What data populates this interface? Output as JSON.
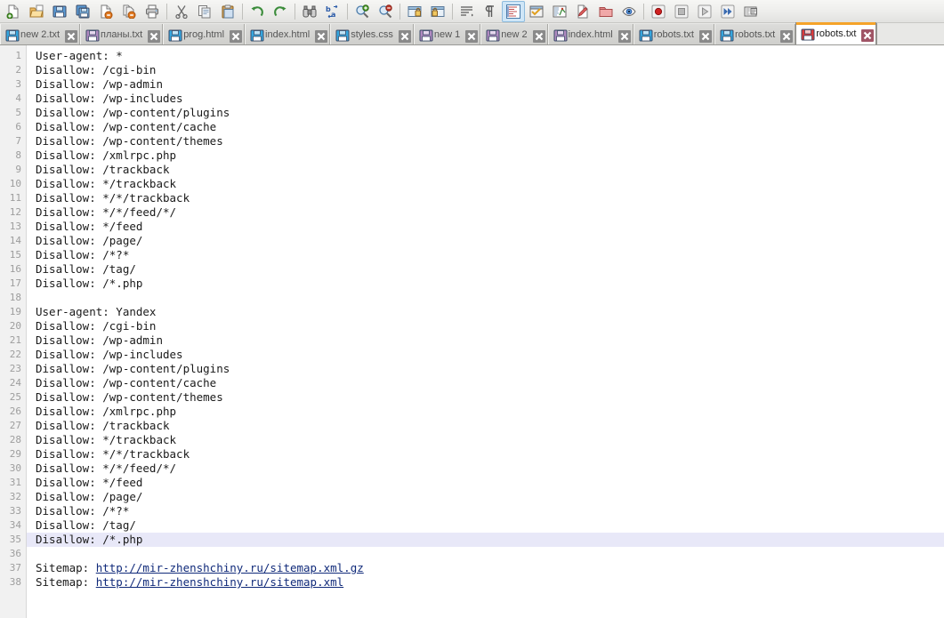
{
  "app": {
    "title": "Notepad++ editor"
  },
  "toolbar": {
    "groups": [
      {
        "name": "file",
        "buttons": [
          {
            "icon": "new-file-icon",
            "label": "New"
          },
          {
            "icon": "open-folder-icon",
            "label": "Open"
          },
          {
            "icon": "save-icon",
            "label": "Save"
          },
          {
            "icon": "save-all-icon",
            "label": "Save All"
          },
          {
            "icon": "close-file-icon",
            "label": "Close"
          },
          {
            "icon": "close-all-icon",
            "label": "Close All"
          },
          {
            "icon": "print-icon",
            "label": "Print"
          }
        ]
      },
      {
        "name": "clipboard",
        "buttons": [
          {
            "icon": "cut-scissors-icon",
            "label": "Cut"
          },
          {
            "icon": "copy-icon",
            "label": "Copy"
          },
          {
            "icon": "paste-icon",
            "label": "Paste"
          }
        ]
      },
      {
        "name": "history",
        "buttons": [
          {
            "icon": "undo-icon",
            "label": "Undo"
          },
          {
            "icon": "redo-icon",
            "label": "Redo"
          }
        ]
      },
      {
        "name": "search",
        "buttons": [
          {
            "icon": "find-binoculars-icon",
            "label": "Find"
          },
          {
            "icon": "replace-icon",
            "label": "Replace"
          }
        ]
      },
      {
        "name": "zoom",
        "buttons": [
          {
            "icon": "zoom-in-icon",
            "label": "Zoom In"
          },
          {
            "icon": "zoom-out-icon",
            "label": "Zoom Out"
          }
        ]
      },
      {
        "name": "sync",
        "buttons": [
          {
            "icon": "sync-vertical-scroll-icon",
            "label": "Synchronize Vertical Scrolling"
          },
          {
            "icon": "sync-horizontal-scroll-icon",
            "label": "Synchronize Horizontal Scrolling"
          }
        ]
      },
      {
        "name": "view",
        "buttons": [
          {
            "icon": "word-wrap-icon",
            "label": "Word Wrap"
          },
          {
            "icon": "show-all-characters-icon",
            "label": "Show All Characters"
          },
          {
            "icon": "show-indent-guide-icon",
            "label": "Show Indent Guide"
          },
          {
            "icon": "user-defined-dialog-icon",
            "label": "User Defined Dialogue"
          },
          {
            "icon": "document-map-icon",
            "label": "Document Map"
          },
          {
            "icon": "function-list-icon",
            "label": "Function List"
          },
          {
            "icon": "folder-workspace-icon",
            "label": "Folder as Workspace"
          },
          {
            "icon": "monitoring-eye-icon",
            "label": "Monitoring"
          }
        ]
      },
      {
        "name": "macro",
        "buttons": [
          {
            "icon": "record-macro-icon",
            "label": "Start Recording"
          },
          {
            "icon": "stop-recording-icon",
            "label": "Stop Recording"
          },
          {
            "icon": "play-macro-icon",
            "label": "Playback"
          },
          {
            "icon": "run-macro-multiple-icon",
            "label": "Run a Macro Multiple Times"
          },
          {
            "icon": "run-dialog-icon",
            "label": "Run"
          }
        ]
      }
    ]
  },
  "tabs": [
    {
      "label": "new 2.txt",
      "icon": "floppy-blue-icon",
      "active": false,
      "close_icon": "close-icon"
    },
    {
      "label": "планы.txt",
      "icon": "floppy-purple-icon",
      "active": false,
      "close_icon": "close-icon"
    },
    {
      "label": "prog.html",
      "icon": "floppy-blue-icon",
      "active": false,
      "close_icon": "close-icon"
    },
    {
      "label": "index.html",
      "icon": "floppy-blue-icon",
      "active": false,
      "close_icon": "close-icon"
    },
    {
      "label": "styles.css",
      "icon": "floppy-blue-icon",
      "active": false,
      "close_icon": "close-icon"
    },
    {
      "label": "new 1",
      "icon": "floppy-purple-icon",
      "active": false,
      "close_icon": "close-icon"
    },
    {
      "label": "new 2",
      "icon": "floppy-purple-icon",
      "active": false,
      "close_icon": "close-icon"
    },
    {
      "label": "index.html",
      "icon": "floppy-purple-icon",
      "active": false,
      "close_icon": "close-icon"
    },
    {
      "label": "robots.txt",
      "icon": "floppy-blue-icon",
      "active": false,
      "close_icon": "close-icon"
    },
    {
      "label": "robots.txt",
      "icon": "floppy-blue-icon",
      "active": false,
      "close_icon": "close-icon"
    },
    {
      "label": "robots.txt",
      "icon": "floppy-red-icon",
      "active": true,
      "close_icon": "close-icon"
    }
  ],
  "colors": {
    "active_tab_accent": "#f5a32a",
    "current_line_highlight": "#e8e8f8",
    "link": "#102a7a",
    "gutter_bg": "#f1f1f1",
    "gutter_text": "#9d9d9d",
    "toolbar_bg": "#ececea",
    "tabbar_bg": "#e8e8e6"
  },
  "editor": {
    "current_line": 35,
    "total_lines": 38,
    "lines": [
      {
        "n": 1,
        "text": "User-agent: *"
      },
      {
        "n": 2,
        "text": "Disallow: /cgi-bin"
      },
      {
        "n": 3,
        "text": "Disallow: /wp-admin"
      },
      {
        "n": 4,
        "text": "Disallow: /wp-includes"
      },
      {
        "n": 5,
        "text": "Disallow: /wp-content/plugins"
      },
      {
        "n": 6,
        "text": "Disallow: /wp-content/cache"
      },
      {
        "n": 7,
        "text": "Disallow: /wp-content/themes"
      },
      {
        "n": 8,
        "text": "Disallow: /xmlrpc.php"
      },
      {
        "n": 9,
        "text": "Disallow: /trackback"
      },
      {
        "n": 10,
        "text": "Disallow: */trackback"
      },
      {
        "n": 11,
        "text": "Disallow: */*/trackback"
      },
      {
        "n": 12,
        "text": "Disallow: */*/feed/*/"
      },
      {
        "n": 13,
        "text": "Disallow: */feed"
      },
      {
        "n": 14,
        "text": "Disallow: /page/"
      },
      {
        "n": 15,
        "text": "Disallow: /*?*"
      },
      {
        "n": 16,
        "text": "Disallow: /tag/"
      },
      {
        "n": 17,
        "text": "Disallow: /*.php"
      },
      {
        "n": 18,
        "text": ""
      },
      {
        "n": 19,
        "text": "User-agent: Yandex"
      },
      {
        "n": 20,
        "text": "Disallow: /cgi-bin"
      },
      {
        "n": 21,
        "text": "Disallow: /wp-admin"
      },
      {
        "n": 22,
        "text": "Disallow: /wp-includes"
      },
      {
        "n": 23,
        "text": "Disallow: /wp-content/plugins"
      },
      {
        "n": 24,
        "text": "Disallow: /wp-content/cache"
      },
      {
        "n": 25,
        "text": "Disallow: /wp-content/themes"
      },
      {
        "n": 26,
        "text": "Disallow: /xmlrpc.php"
      },
      {
        "n": 27,
        "text": "Disallow: /trackback"
      },
      {
        "n": 28,
        "text": "Disallow: */trackback"
      },
      {
        "n": 29,
        "text": "Disallow: */*/trackback"
      },
      {
        "n": 30,
        "text": "Disallow: */*/feed/*/"
      },
      {
        "n": 31,
        "text": "Disallow: */feed"
      },
      {
        "n": 32,
        "text": "Disallow: /page/"
      },
      {
        "n": 33,
        "text": "Disallow: /*?*"
      },
      {
        "n": 34,
        "text": "Disallow: /tag/"
      },
      {
        "n": 35,
        "text": "Disallow: /*.php"
      },
      {
        "n": 36,
        "text": ""
      },
      {
        "n": 37,
        "prefix": "Sitemap: ",
        "link": "http://mir-zhenshchiny.ru/sitemap.xml.gz"
      },
      {
        "n": 38,
        "prefix": "Sitemap: ",
        "link": "http://mir-zhenshchiny.ru/sitemap.xml"
      }
    ]
  }
}
